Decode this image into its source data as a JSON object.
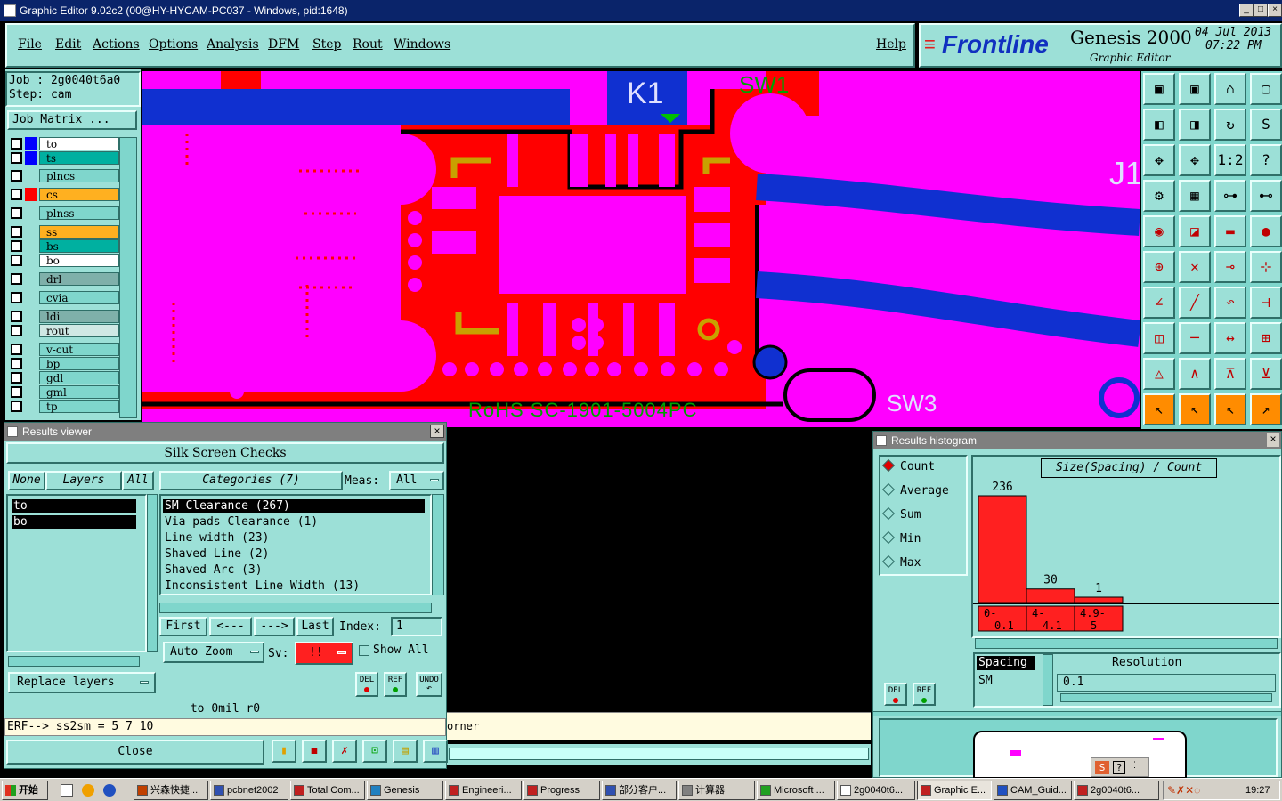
{
  "window": {
    "title": "Graphic Editor 9.02c2 (00@HY-HYCAM-PC037 - Windows, pid:1648)"
  },
  "menu": {
    "items": [
      "File",
      "Edit",
      "Actions",
      "Options",
      "Analysis",
      "DFM",
      "Step",
      "Rout",
      "Windows"
    ],
    "help": "Help"
  },
  "brand": {
    "logo": "Frontline",
    "product": "Genesis 2000",
    "subtitle": "Graphic Editor",
    "date": "04 Jul 2013",
    "time": "07:22 PM"
  },
  "job": {
    "job_label": "Job : 2g0040t6a0",
    "step_label": "Step: cam",
    "matrix_button": "Job Matrix ..."
  },
  "layers": [
    {
      "name": "to",
      "color": "#ffffff",
      "swatch": "#0000ff",
      "swatch2": "#00a000"
    },
    {
      "name": "ts",
      "color": "#00b0a0",
      "swatch": "#0000ff"
    },
    {
      "name": "plncs",
      "color": "#7fd6cc"
    },
    {
      "name": "cs",
      "color": "#ffb020",
      "swatch": "#ff0000"
    },
    {
      "name": "plnss",
      "color": "#7fd6cc"
    },
    {
      "name": "ss",
      "color": "#ffb020"
    },
    {
      "name": "bs",
      "color": "#00b0a0"
    },
    {
      "name": "bo",
      "color": "#ffffff"
    },
    {
      "name": "drl",
      "color": "#7fb0aa"
    },
    {
      "name": "cvia",
      "color": "#7fd6cc"
    },
    {
      "name": "ldi",
      "color": "#7fb0aa"
    },
    {
      "name": "rout",
      "color": "#cfe8e4"
    },
    {
      "name": "v-cut",
      "color": "#7fd6cc"
    },
    {
      "name": "bp",
      "color": "#7fd6cc"
    },
    {
      "name": "gdl",
      "color": "#7fd6cc"
    },
    {
      "name": "gml",
      "color": "#7fd6cc"
    },
    {
      "name": "tp",
      "color": "#7fd6cc"
    }
  ],
  "canvas": {
    "labels": {
      "k1": "K1",
      "sw1": "SW1",
      "sw3": "SW3",
      "j1": "J1",
      "rohs": "RoHS SC-1901-5004PC"
    }
  },
  "results_viewer": {
    "title": "Results viewer",
    "header": "Silk Screen Checks",
    "none_btn": "None",
    "layers_btn": "Layers",
    "all_btn": "All",
    "categories_btn": "Categories (7)",
    "meas_label": "Meas:",
    "meas_value": "All",
    "layer_list": [
      "to",
      "bo"
    ],
    "categories": [
      "SM Clearance (267)",
      "Via pads Clearance (1)",
      "Line width (23)",
      "Shaved Line (2)",
      "Shaved Arc (3)",
      "Inconsistent Line Width (13)"
    ],
    "first": "First",
    "prev": "<---",
    "next": "--->",
    "last": "Last",
    "index_label": "Index:",
    "index_value": "1",
    "auto_zoom": "Auto Zoom",
    "sv_label": "Sv:",
    "sv_value": "!!",
    "show_all": "Show All",
    "replace_layers": "Replace layers",
    "del": "DEL",
    "ref": "REF",
    "undo": "UNDO",
    "status": "to 0mil r0",
    "erf": "ERF--> ss2sm = 5 7 10",
    "close": "Close",
    "tail_text": "orner"
  },
  "histogram": {
    "title": "Results histogram",
    "modes": [
      "Count",
      "Average",
      "Sum",
      "Min",
      "Max"
    ],
    "selected_mode": "Count",
    "axis_label": "Size(Spacing) / Count",
    "bars": [
      {
        "range": "0-\n0.1",
        "count": 236
      },
      {
        "range": "4-\n4.1",
        "count": 30
      },
      {
        "range": "4.9-\n5",
        "count": 1
      }
    ],
    "spacing_item": "Spacing",
    "sm_item": "SM",
    "resolution_label": "Resolution",
    "resolution_value": "0.1",
    "del": "DEL",
    "ref": "REF"
  },
  "taskbar": {
    "start": "开始",
    "tasks": [
      "兴森快捷...",
      "pcbnet2002",
      "Total Com...",
      "Genesis",
      "Engineeri...",
      "Progress",
      "部分客户...",
      "计算器",
      "Microsoft ...",
      "2g0040t6...",
      "Graphic E...",
      "CAM_Guid...",
      "2g0040t6..."
    ],
    "clock": "19:27"
  }
}
